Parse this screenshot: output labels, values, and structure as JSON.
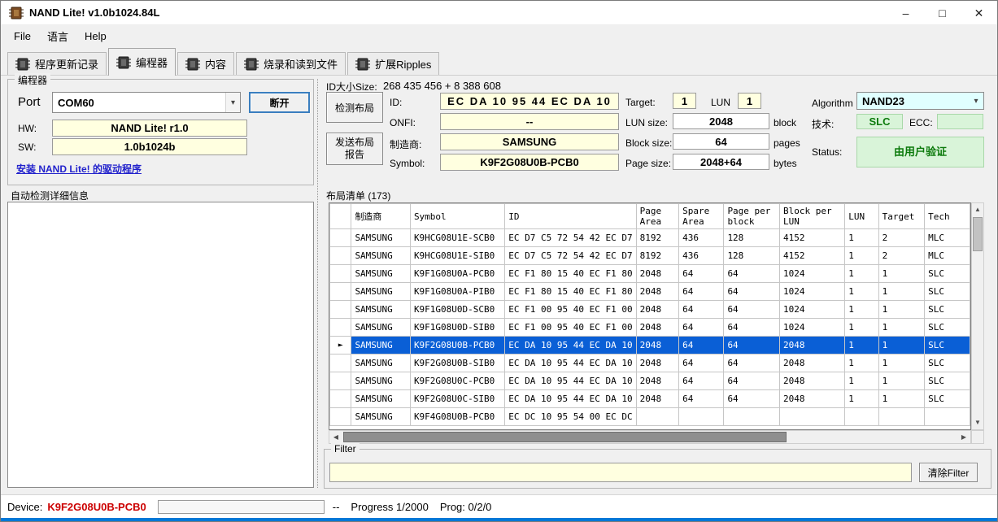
{
  "colors": {
    "selection_blue": "#0a5fd6",
    "device_red": "#cc0000",
    "field_yellow": "#ffffe0",
    "green_bg": "#d9f4d9",
    "algorithm_cyan": "#e0ffff",
    "accent_strip": "#0078d7"
  },
  "window": {
    "title": "NAND Lite! v1.0b1024.84L",
    "controls": {
      "minimize": "–",
      "maximize": "□",
      "close": "✕"
    }
  },
  "menu": {
    "items": [
      "File",
      "语言",
      "Help"
    ]
  },
  "tabs": [
    {
      "label": "程序更新记录"
    },
    {
      "label": "编程器"
    },
    {
      "label": "内容"
    },
    {
      "label": "烧录和读到文件"
    },
    {
      "label": "扩展Ripples"
    }
  ],
  "programmer": {
    "group_title": "编程器",
    "port_label": "Port",
    "port_value": "COM60",
    "disconnect_button": "断开",
    "hw_label": "HW:",
    "hw_value": "NAND Lite! r1.0",
    "sw_label": "SW:",
    "sw_value": "1.0b1024b",
    "driver_link": "安装 NAND Lite! 的驱动程序"
  },
  "auto_detect": {
    "label": "自动检测详细信息",
    "content": ""
  },
  "detect": {
    "id_size_label": "ID大小Size:",
    "id_size_value": "268 435 456  +  8 388 608",
    "detect_button": "检测布局",
    "send_report_button": "发送布局\n报告",
    "id_label": "ID:",
    "id_value": "EC DA 10 95 44 EC DA 10",
    "onfi_label": "ONFI:",
    "onfi_value": "--",
    "mfr_label": "制造商:",
    "mfr_value": "SAMSUNG",
    "symbol_label": "Symbol:",
    "symbol_value": "K9F2G08U0B-PCB0",
    "target_label": "Target:",
    "target_value": "1",
    "lun_label": "LUN",
    "lun_value": "1",
    "lun_size_label": "LUN size:",
    "lun_size_value": "2048",
    "lun_size_unit": "block",
    "block_size_label": "Block size::",
    "block_size_value": "64",
    "block_size_unit": "pages",
    "page_size_label": "Page size:",
    "page_size_value": "2048+64",
    "page_size_unit": "bytes",
    "algorithm_label": "Algorithm",
    "algorithm_value": "NAND23",
    "tech_label": "技术:",
    "tech_value": "SLC",
    "ecc_label": "ECC:",
    "ecc_value": "",
    "status_label": "Status:",
    "status_value": "由用户验证"
  },
  "layout_list": {
    "title": "布局清单 (173)",
    "columns": [
      "",
      "制造商",
      "Symbol",
      "ID",
      "Page Area",
      "Spare Area",
      "Page per block",
      "Block per LUN",
      "LUN",
      "Target",
      "Tech"
    ],
    "selected_index": 6,
    "rows": [
      [
        "SAMSUNG",
        "K9HCG08U1E-SCB0",
        "EC D7 C5 72 54 42 EC D7",
        "8192",
        "436",
        "128",
        "4152",
        "1",
        "2",
        "MLC"
      ],
      [
        "SAMSUNG",
        "K9HCG08U1E-SIB0",
        "EC D7 C5 72 54 42 EC D7",
        "8192",
        "436",
        "128",
        "4152",
        "1",
        "2",
        "MLC"
      ],
      [
        "SAMSUNG",
        "K9F1G08U0A-PCB0",
        "EC F1 80 15 40 EC F1 80",
        "2048",
        "64",
        "64",
        "1024",
        "1",
        "1",
        "SLC"
      ],
      [
        "SAMSUNG",
        "K9F1G08U0A-PIB0",
        "EC F1 80 15 40 EC F1 80",
        "2048",
        "64",
        "64",
        "1024",
        "1",
        "1",
        "SLC"
      ],
      [
        "SAMSUNG",
        "K9F1G08U0D-SCB0",
        "EC F1 00 95 40 EC F1 00",
        "2048",
        "64",
        "64",
        "1024",
        "1",
        "1",
        "SLC"
      ],
      [
        "SAMSUNG",
        "K9F1G08U0D-SIB0",
        "EC F1 00 95 40 EC F1 00",
        "2048",
        "64",
        "64",
        "1024",
        "1",
        "1",
        "SLC"
      ],
      [
        "SAMSUNG",
        "K9F2G08U0B-PCB0",
        "EC DA 10 95 44 EC DA 10",
        "2048",
        "64",
        "64",
        "2048",
        "1",
        "1",
        "SLC"
      ],
      [
        "SAMSUNG",
        "K9F2G08U0B-SIB0",
        "EC DA 10 95 44 EC DA 10",
        "2048",
        "64",
        "64",
        "2048",
        "1",
        "1",
        "SLC"
      ],
      [
        "SAMSUNG",
        "K9F2G08U0C-PCB0",
        "EC DA 10 95 44 EC DA 10",
        "2048",
        "64",
        "64",
        "2048",
        "1",
        "1",
        "SLC"
      ],
      [
        "SAMSUNG",
        "K9F2G08U0C-SIB0",
        "EC DA 10 95 44 EC DA 10",
        "2048",
        "64",
        "64",
        "2048",
        "1",
        "1",
        "SLC"
      ],
      [
        "SAMSUNG",
        "K9F4G08U0B-PCB0",
        "EC DC 10 95 54 00 EC DC",
        "",
        "",
        "",
        "",
        "",
        "",
        ""
      ]
    ]
  },
  "filter": {
    "group_title": "Filter",
    "value": "",
    "clear_button": "清除Filter"
  },
  "statusbar": {
    "device_label": "Device:",
    "device_value": "K9F2G08U0B-PCB0",
    "sep": "--",
    "progress_text": "Progress 1/2000",
    "prog_text": "Prog: 0/2/0"
  }
}
